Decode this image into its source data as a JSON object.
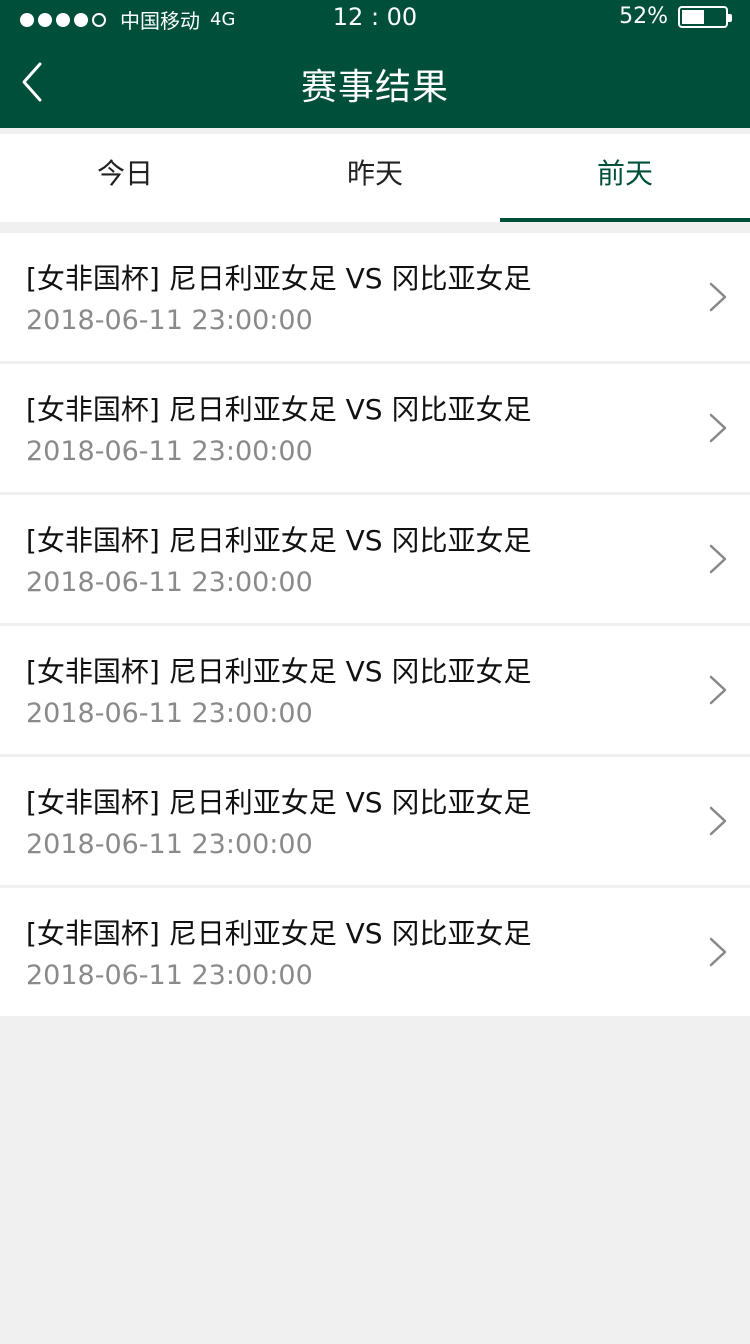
{
  "status_bar": {
    "carrier": "中国移动",
    "network": "4G",
    "time": "12 : 00",
    "battery_percent": "52%",
    "battery_level": 0.52,
    "signal_dots_filled": 4,
    "signal_dots_total": 5
  },
  "header": {
    "title": "赛事结果",
    "back_icon": "chevron-left-icon"
  },
  "tabs": [
    {
      "label": "今日",
      "active": false
    },
    {
      "label": "昨天",
      "active": false
    },
    {
      "label": "前天",
      "active": true
    }
  ],
  "matches": [
    {
      "title": "[女非国杯] 尼日利亚女足 VS 冈比亚女足",
      "time": "2018-06-11 23:00:00"
    },
    {
      "title": "[女非国杯] 尼日利亚女足 VS 冈比亚女足",
      "time": "2018-06-11 23:00:00"
    },
    {
      "title": "[女非国杯] 尼日利亚女足 VS 冈比亚女足",
      "time": "2018-06-11 23:00:00"
    },
    {
      "title": "[女非国杯] 尼日利亚女足 VS 冈比亚女足",
      "time": "2018-06-11 23:00:00"
    },
    {
      "title": "[女非国杯] 尼日利亚女足 VS 冈比亚女足",
      "time": "2018-06-11 23:00:00"
    },
    {
      "title": "[女非国杯] 尼日利亚女足 VS 冈比亚女足",
      "time": "2018-06-11 23:00:00"
    }
  ],
  "colors": {
    "brand": "#004f3b",
    "background": "#f0f0f0",
    "secondary_text": "#8a8a8a"
  }
}
